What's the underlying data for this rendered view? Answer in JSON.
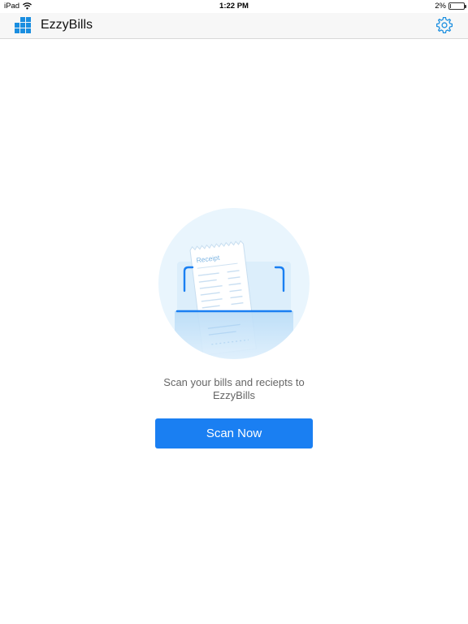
{
  "status_bar": {
    "device": "iPad",
    "time": "1:22 PM",
    "battery_percent": "2%",
    "battery_level": 0.02,
    "icons": [
      "wifi-icon",
      "battery-icon"
    ]
  },
  "nav": {
    "title": "EzzyBills",
    "logo": "ezzybills-logo-icon",
    "settings_icon": "gear-icon",
    "accent_color": "#1a8ee0"
  },
  "main": {
    "illustration": "receipt-scan-illustration",
    "receipt_label": "Receipt",
    "message_line1": "Scan your bills and reciepts to",
    "message_line2": "EzzyBills",
    "scan_button_label": "Scan Now",
    "button_color": "#1a7ff2"
  }
}
